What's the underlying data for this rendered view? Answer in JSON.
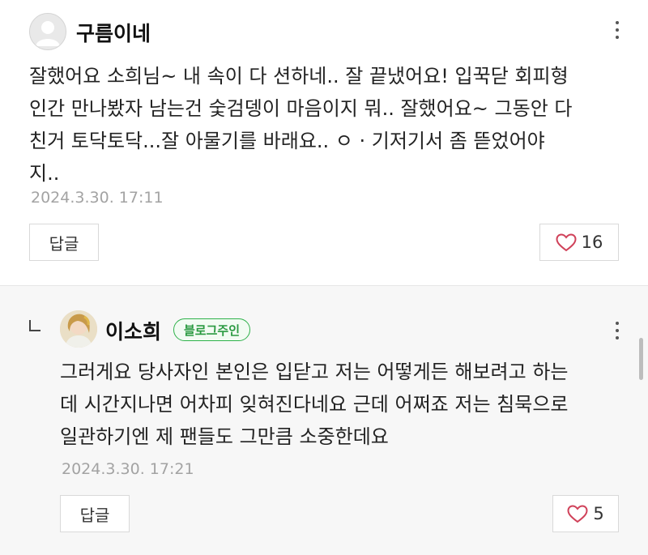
{
  "comment1": {
    "author": "구름이네",
    "body_lines": [
      "잘했어요 소희님~ 내 속이 다 션하네.. 잘 끝냈어요! 입꾹닫 회피형",
      "인간 만나봤자 남는건 숯검뎅이 마음이지 뭐.. 잘했어요~ 그동안 다",
      "친거 토닥토닥...잘 아물기를 바래요.. ㅇ · 기저기서 좀 뜯었어야",
      "지.."
    ],
    "date": "2024.3.30.  17:11",
    "reply_label": "답글",
    "like_count": "16"
  },
  "comment2": {
    "author": "이소희",
    "badge": "블로그주인",
    "body_lines": [
      "그러게요 당사자인 본인은 입닫고 저는 어떻게든 해보려고 하는",
      "데 시간지나면 어차피 잊혀진다네요 근데 어쩌죠 저는 침묵으로",
      "일관하기엔 제 팬들도 그만큼 소중한데요"
    ],
    "date": "2024.3.30.  17:21",
    "reply_label": "답글",
    "like_count": "5"
  },
  "colors": {
    "badge_green": "#2fb24b",
    "reply_background": "#f7f7f7",
    "date_gray": "#a3a3a3"
  },
  "icons": {
    "avatar_default": "default-avatar-icon",
    "more": "more-vertical-icon",
    "like": "heart-outline-icon",
    "reply_indicator": "reply-arrow-icon"
  }
}
